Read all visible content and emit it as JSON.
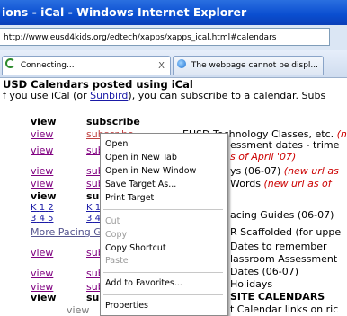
{
  "window": {
    "title": "ions - iCal - Windows Internet Explorer"
  },
  "address": {
    "url": "http://www.eusd4kids.org/edtech/xapps/xapps_ical.html#calendars"
  },
  "tabs": [
    {
      "label": "Connecting...",
      "close": "X"
    },
    {
      "label": "The webpage cannot be displ..."
    }
  ],
  "page": {
    "heading": "USD Calendars posted using iCal",
    "intro_pre": "f you use iCal (or ",
    "intro_link": "Sunbird",
    "intro_post": "), you can subscribe to a calendar. Subs",
    "col_view": "view",
    "col_subscribe": "subscribe",
    "rows": {
      "r1": {
        "view": "view",
        "sub": "subscribe",
        "desc": "EUSD Technology Classes, etc. ",
        "desc_red": "(new"
      },
      "r2": {
        "view": "view",
        "sub": "subsc",
        "desc": "essment dates - trime",
        "desc_red": "s of April '07)"
      },
      "r3": {
        "view": "view",
        "sub": "subsc",
        "desc": "ys (06-07) ",
        "desc_red": "(new url as"
      },
      "r4": {
        "view": "view",
        "sub": "subsc",
        "desc": "Words ",
        "desc_red": "(new url as of"
      },
      "r5": {
        "view": "view",
        "sub": "subsc"
      },
      "r6": {
        "k1": "K",
        "k2": "1",
        "k3": "2",
        "a3": "3",
        "a4": "4",
        "a5": "5",
        "s1": "K",
        "s2": "1",
        "s3": "3",
        "s4": "4",
        "desc": "acing Guides (06-07)"
      },
      "r7": {
        "view": "More Pacing Guid",
        "desc": "R Scaffolded (for uppe"
      },
      "r8": {
        "view": "view",
        "sub": "subsc",
        "desc1": "Dates to remember",
        "desc2": "lassroom Assessment"
      },
      "r9": {
        "view": "view",
        "sub": "subsc",
        "desc": "Dates (06-07)"
      },
      "r10": {
        "view": "view",
        "sub": "subsc",
        "desc": "Holidays"
      },
      "r11": {
        "view": "view",
        "sub": "subsc",
        "desc": "SITE CALENDARS"
      },
      "r12": {
        "view": "view",
        "desc": "t Calendar links on ric"
      }
    }
  },
  "context_menu": {
    "open": "Open",
    "open_tab": "Open in New Tab",
    "open_window": "Open in New Window",
    "save_target": "Save Target As...",
    "print_target": "Print Target",
    "cut": "Cut",
    "copy": "Copy",
    "copy_shortcut": "Copy Shortcut",
    "paste": "Paste",
    "add_favorites": "Add to Favorites...",
    "properties": "Properties"
  },
  "colors": {
    "title_bar": "#0a4ed0",
    "link": "#1a1aa6",
    "visited": "#800080",
    "note": "#cc0000"
  }
}
